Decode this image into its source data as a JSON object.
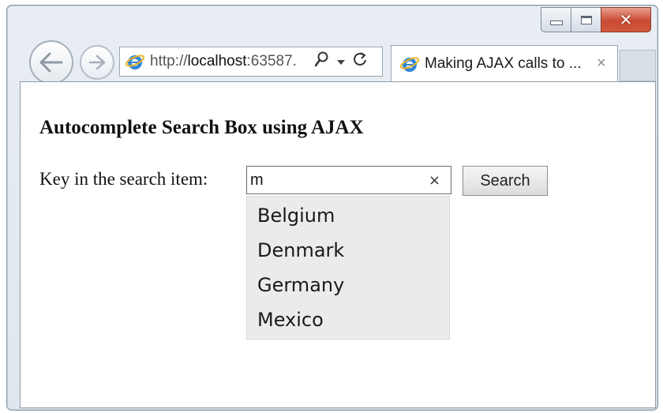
{
  "browser": {
    "url_prefix": "http://",
    "url_host": "localhost",
    "url_rest": ":63587.",
    "tab_title": "Making AJAX calls to ...",
    "tab_close": "×",
    "icons": {
      "back": "back-arrow-icon",
      "forward": "forward-arrow-icon",
      "search": "search-icon",
      "dropdown": "chevron-down-icon",
      "refresh": "refresh-icon",
      "browser": "internet-explorer-icon"
    },
    "caption": {
      "close": "✕"
    }
  },
  "page": {
    "title": "Autocomplete Search Box using AJAX",
    "search_label": "Key in the search item:",
    "search_value": "m",
    "clear_glyph": "×",
    "search_button": "Search",
    "suggestions": [
      "Belgium",
      "Denmark",
      "Germany",
      "Mexico"
    ]
  },
  "colors": {
    "close_button": "#c94a33",
    "suggestion_bg": "#ebebeb"
  }
}
